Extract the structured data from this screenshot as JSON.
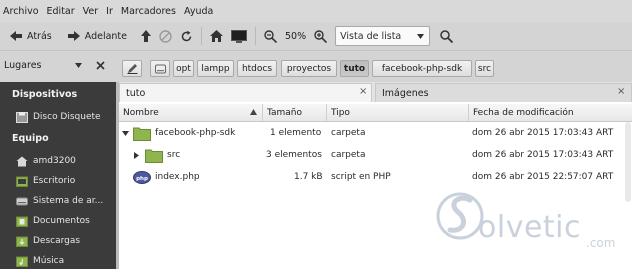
{
  "menu": [
    "Archivo",
    "Editar",
    "Ver",
    "Ir",
    "Marcadores",
    "Ayuda"
  ],
  "toolbar": {
    "back_label": "Atrás",
    "forward_label": "Adelante",
    "zoom_level": "50%",
    "view_mode": "Vista de lista"
  },
  "location": {
    "panel_title": "Lugares",
    "breadcrumbs": [
      "opt",
      "lampp",
      "htdocs",
      "proyectos",
      "tuto",
      "facebook-php-sdk",
      "src"
    ],
    "active_crumb": "tuto"
  },
  "sidebar": {
    "sections": [
      {
        "title": "Dispositivos",
        "items": [
          "Disco Disquete"
        ]
      },
      {
        "title": "Equipo",
        "items": [
          "amd3200",
          "Escritorio",
          "Sistema de ar...",
          "Documentos",
          "Descargas",
          "Música"
        ]
      }
    ]
  },
  "tabs": [
    {
      "label": "tuto"
    },
    {
      "label": "Imágenes"
    }
  ],
  "columns": [
    "Nombre",
    "Tamaño",
    "Tipo",
    "Fecha de modificación"
  ],
  "files": [
    {
      "name": "facebook-php-sdk",
      "size": "1 elemento",
      "type": "carpeta",
      "modified": "dom 26 abr 2015 17:03:43 ART",
      "icon": "folder-icon",
      "expanded": true,
      "depth": 0
    },
    {
      "name": "src",
      "size": "3 elementos",
      "type": "carpeta",
      "modified": "dom 26 abr 2015 17:03:43 ART",
      "icon": "folder-icon",
      "expanded": false,
      "depth": 1
    },
    {
      "name": "index.php",
      "size": "1.7 kB",
      "type": "script en PHP",
      "modified": "dom 26 abr 2015 22:57:07 ART",
      "icon": "php-file-icon",
      "expanded": null,
      "depth": 0
    }
  ],
  "watermark": {
    "text": "olvetic",
    "suffix": ".com"
  },
  "colors": {
    "sidebar_bg": "#3b3b3b",
    "folder_green": "#8fb54d",
    "selected_crumb": "#c4c4c4"
  }
}
